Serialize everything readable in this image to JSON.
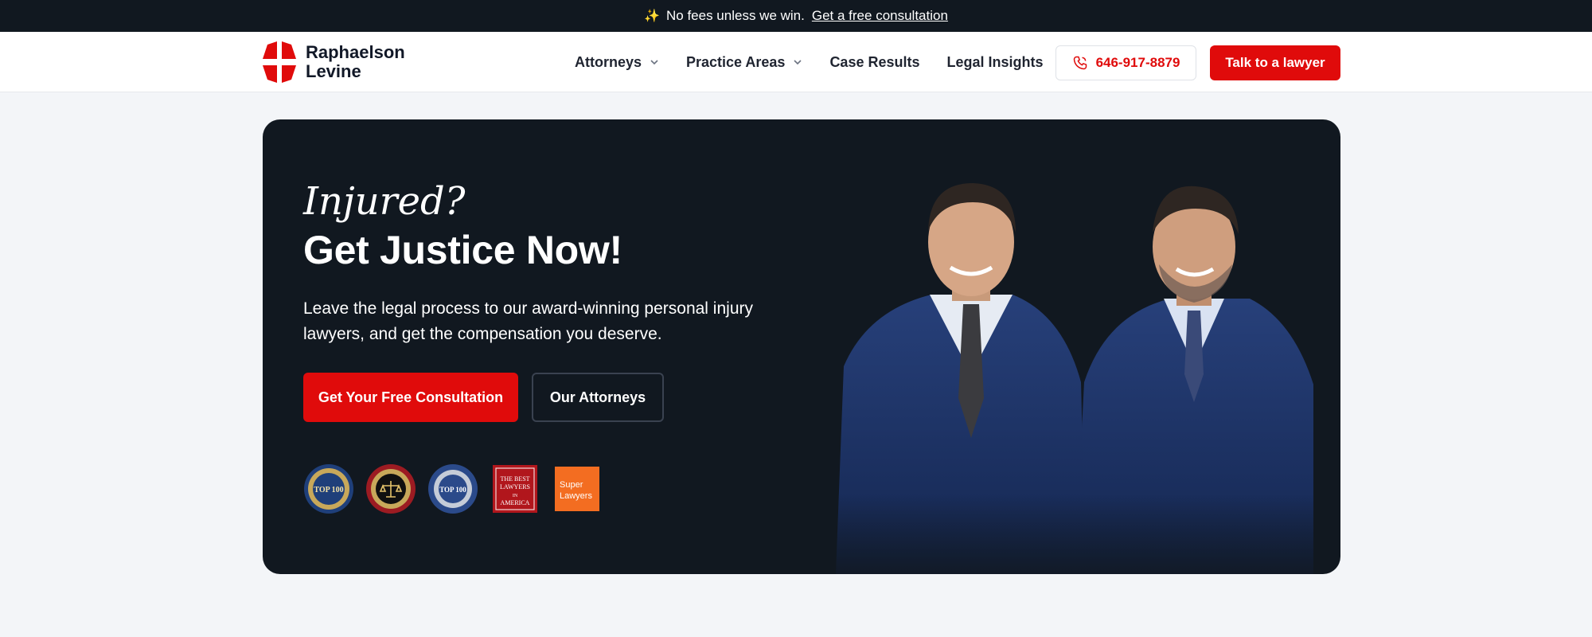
{
  "announcement": {
    "text": "No fees unless we win.",
    "link": "Get a free consultation"
  },
  "brand": {
    "name_line1": "Raphaelson",
    "name_line2": "Levine",
    "accent": "#e00b0b",
    "dark": "#111820"
  },
  "nav": {
    "items": [
      {
        "label": "Attorneys",
        "has_dropdown": true
      },
      {
        "label": "Practice Areas",
        "has_dropdown": true
      },
      {
        "label": "Case Results",
        "has_dropdown": false
      },
      {
        "label": "Legal Insights",
        "has_dropdown": false
      }
    ],
    "phone": "646-917-8879",
    "talk_label": "Talk to a lawyer"
  },
  "hero": {
    "eyebrow": "Injured?",
    "title": "Get Justice Now!",
    "description": "Leave the legal process to our award-winning personal injury lawyers, and get the compensation you deserve.",
    "primary_cta": "Get Your Free Consultation",
    "secondary_cta": "Our Attorneys"
  },
  "badges": [
    {
      "name": "The National Top 100 Trial Lawyers",
      "text": "TOP 100"
    },
    {
      "name": "Multi-Million Dollar Advocates Forum",
      "text": "MULTI-MILLION DOLLAR"
    },
    {
      "name": "America's Top 100 Attorneys",
      "text": "TOP 100"
    },
    {
      "name": "The Best Lawyers in America",
      "text": "THE BEST LAWYERS IN AMERICA"
    },
    {
      "name": "Super Lawyers",
      "text": "Super Lawyers"
    }
  ],
  "icons": {
    "sparkle": "sparkle-icon",
    "phone": "phone-icon",
    "chevron": "chevron-down-icon"
  }
}
